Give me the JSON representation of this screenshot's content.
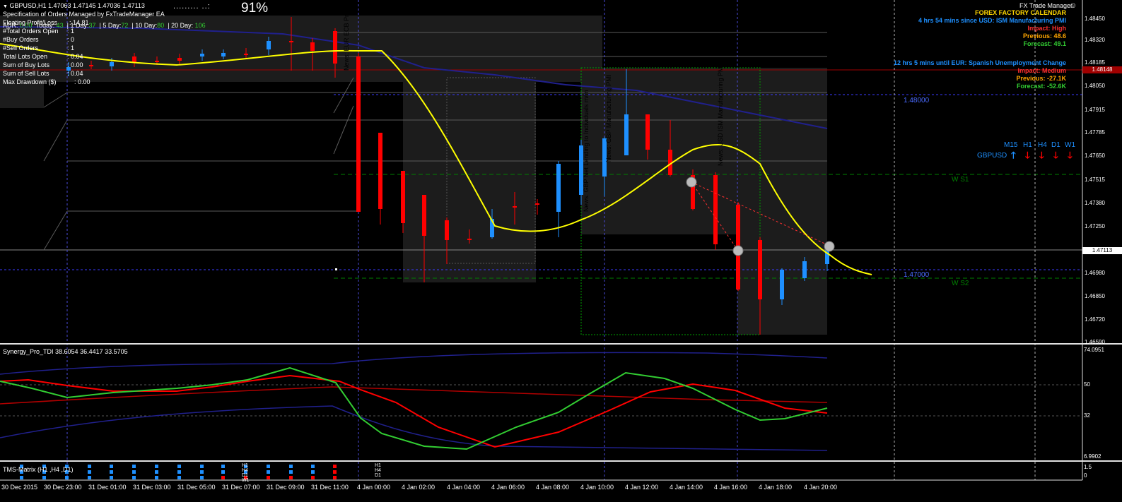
{
  "header": {
    "symbol_line": "GBPUSD,H1  1.47063 1.47145 1.47036 1.47113",
    "subtitle": "Specification of Orders Managed by FxTradeManager EA",
    "percent": "91%",
    "progress_dots": "......... ..:",
    "adr_label": "ADR:",
    "adr_value": "0.00",
    "today_label": "Today:",
    "today_value": "43",
    "day1": "1 Day:",
    "day1_value": "37",
    "day5": "5 Day:",
    "day5_value": "72",
    "day10": "10 Day:",
    "day10_value": "80",
    "day20": "20 Day:",
    "day20_value": "106"
  },
  "stats": [
    {
      "label": "Floating Profit/Loss",
      "value": ": 14.81"
    },
    {
      "label": "#Total Orders Open",
      "value": ": 1"
    },
    {
      "label": "#Buy Orders",
      "value": ": 0"
    },
    {
      "label": "#Sell Orders",
      "value": ": 1"
    },
    {
      "label": "Total Lots Open",
      "value": ": 0.04"
    },
    {
      "label": "Sum of Buy Lots",
      "value": ": 0.00"
    },
    {
      "label": "Sum of Sell Lots",
      "value": ": 0.04"
    },
    {
      "label": "Max Drawdown ($)",
      "value": ": 0.00"
    }
  ],
  "calendar": {
    "app_title": "FX Trade Manager",
    "title": "FOREX FACTORY CALENDAR",
    "event1": "4 hrs 54 mins since USD: ISM Manufacturing PMI",
    "event1_impact": "Impact: High",
    "event1_prev": "Previous: 48.6",
    "event1_forecast": "Forecast: 49.1",
    "event2": "12 hrs 5 mins until EUR: Spanish Unemployment Change",
    "event2_impact": "Impact: Medium",
    "event2_prev": "Previous: -27.1K",
    "event2_forecast": "Forecast: -52.6K"
  },
  "matrix": {
    "symbol": "GBPUSD",
    "timeframes": [
      "M15",
      "H1",
      "H4",
      "D1",
      "W1"
    ],
    "directions": [
      "up",
      "down",
      "down",
      "down",
      "down"
    ]
  },
  "levels": {
    "l1": "1.48000",
    "l2": "1.47000",
    "s1": "W S1",
    "s2": "W S2",
    "current_price": "1.47113",
    "top_box": "1.48148"
  },
  "price_axis": [
    "1.48450",
    "1.48320",
    "1.48185",
    "1.48050",
    "1.47915",
    "1.47785",
    "1.47650",
    "1.47515",
    "1.47380",
    "1.47250",
    "1.47113",
    "1.46980",
    "1.46850",
    "1.46720",
    "1.46590"
  ],
  "news_labels": [
    "News: EUR ECB President Draghi Speaks",
    "News: GBP Net Lending to Individuals m/m",
    "News: GBP Manufacturing PMI",
    "News: USD ISM Manufacturing PMI"
  ],
  "indicator1": {
    "label": "Synergy_Pro_TDI 38.6054 36.4417 33.5705",
    "axis": [
      "74.0951",
      "50",
      "32",
      "6.9902"
    ]
  },
  "indicator2": {
    "label": "TMS-Matrix (H1 ,H4 ,D1)",
    "axis": [
      "1.5",
      "0"
    ],
    "tf_labels": [
      "H1",
      "H4",
      "D1",
      "W1"
    ]
  },
  "time_axis": [
    "30 Dec 2015",
    "30 Dec 23:00",
    "31 Dec 01:00",
    "31 Dec 03:00",
    "31 Dec 05:00",
    "31 Dec 07:00",
    "31 Dec 09:00",
    "31 Dec 11:00",
    "4 Jan 00:00",
    "4 Jan 02:00",
    "4 Jan 04:00",
    "4 Jan 06:00",
    "4 Jan 08:00",
    "4 Jan 10:00",
    "4 Jan 12:00",
    "4 Jan 14:00",
    "4 Jan 16:00",
    "4 Jan 18:00",
    "4 Jan 20:00"
  ],
  "colors": {
    "up": "#1e90ff",
    "down": "#ff0000",
    "ma_yellow": "#ffff00",
    "ma_navy": "#1e1e8c",
    "grid": "#3a3a3a",
    "cal_title": "#ffd700",
    "cal_event": "#1e90ff",
    "impact": "#ff3030",
    "prev": "#ffa500",
    "forecast": "#32cd32"
  }
}
